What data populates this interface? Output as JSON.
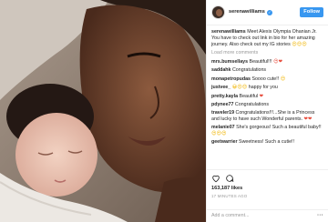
{
  "header": {
    "username": "serenawilliams",
    "verified_icon": "verified-badge-icon",
    "follow_label": "Follow"
  },
  "caption": {
    "username": "serenawilliams",
    "text": "Meet Alexis Olympia Ohanian Jr. You have to check out link in bio for her amazing journey. Also check out my IG stories",
    "emoji": "😍😍😍"
  },
  "load_more_label": "Load more comments",
  "comments": [
    {
      "username": "mrs.bumsellays",
      "text": "Beautiful!!!",
      "emoji": "😍❤"
    },
    {
      "username": "saddahk",
      "text": "Congratulations",
      "emoji": ""
    },
    {
      "username": "monapetropudas",
      "text": "Soooo cute!!",
      "emoji": "😍"
    },
    {
      "username": "justvee_",
      "text": "happy for you",
      "emoji": "😀😍😍"
    },
    {
      "username": "pretty.kayla",
      "text": "Beautiful",
      "emoji": "❤"
    },
    {
      "username": "pdynee77",
      "text": "Congratulations",
      "emoji": ""
    },
    {
      "username": "traveler19",
      "text": "Congratulations!!!...She is a Princess and lucky to have such Wonderful parents.",
      "emoji": "❤❤"
    },
    {
      "username": "melanie07",
      "text": "She's gorgeous! Such a beautiful baby!!",
      "emoji": "😍😍😍"
    },
    {
      "username": "geetwarrier",
      "text": "Sweetness! Such a cutie!!",
      "emoji": ""
    }
  ],
  "actions": {
    "likes": "163,187 likes",
    "date": "17 MINUTES AGO"
  },
  "add_comment": {
    "placeholder": "Add a comment...",
    "more": "···"
  }
}
